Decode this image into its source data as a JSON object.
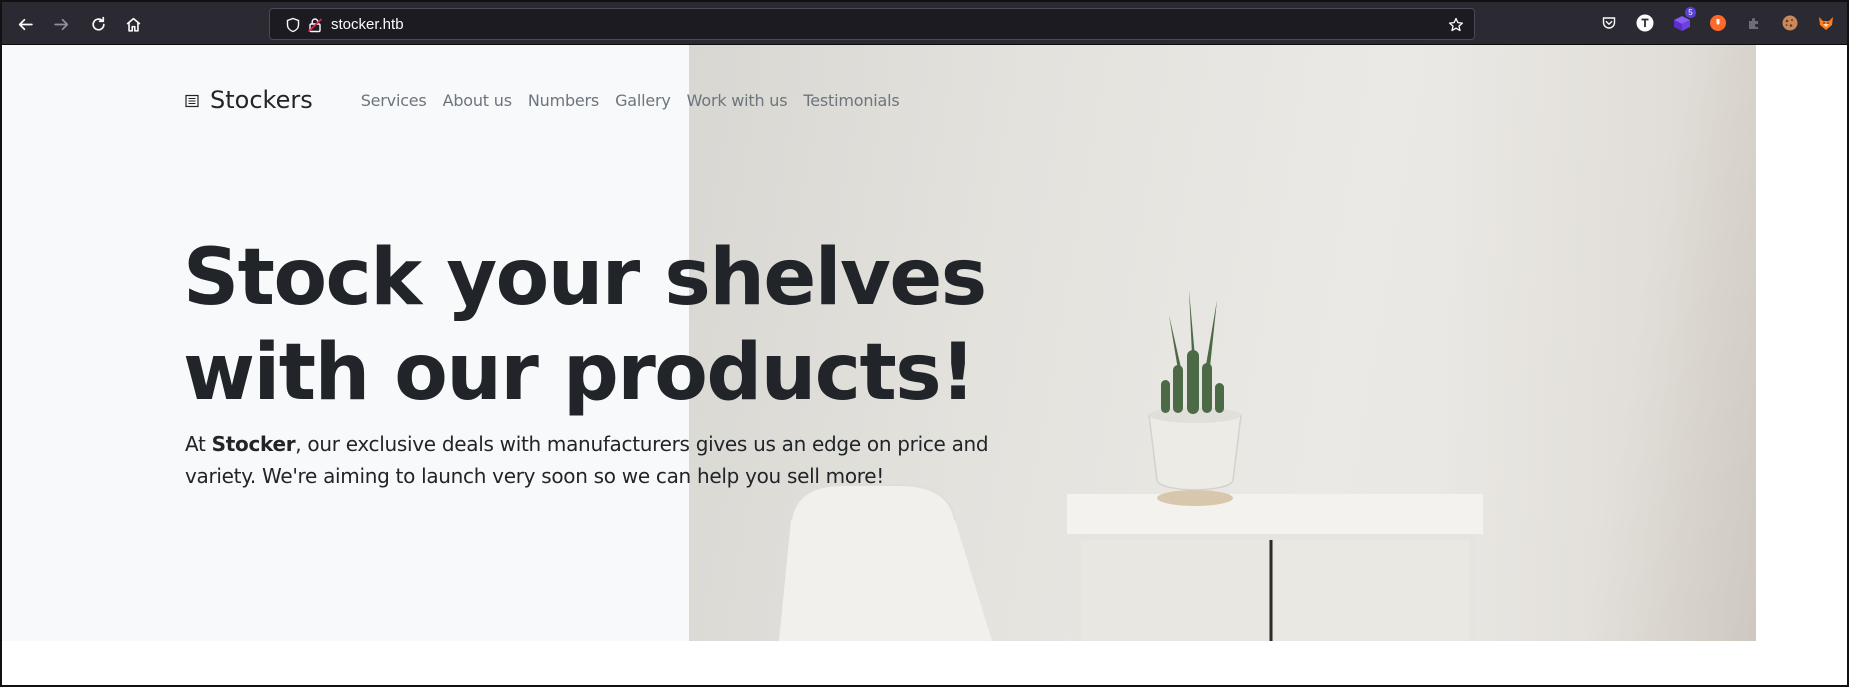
{
  "browser": {
    "url": "stocker.htb",
    "extension_badge": "5"
  },
  "site": {
    "brand": "Stockers",
    "nav": [
      "Services",
      "About us",
      "Numbers",
      "Gallery",
      "Work with us",
      "Testimonials"
    ],
    "headline_line1": "Stock your shelves",
    "headline_line2": "with our products!",
    "lead_prefix": "At ",
    "lead_bold": "Stocker",
    "lead_rest": ", our exclusive deals with manufacturers gives us an edge on price and variety. We're aiming to launch very soon so we can help you sell more!"
  },
  "colors": {
    "toolbar_bg": "#2b2a33",
    "hero_bg": "#f8f9fa",
    "text_dark": "#212529",
    "nav_link": "#6c757d"
  }
}
